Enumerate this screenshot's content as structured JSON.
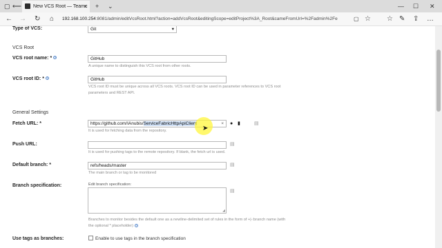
{
  "browser": {
    "tab_title": "New VCS Root — Teamc",
    "tab_close": "×",
    "new_tab": "+",
    "chevron": "⌄",
    "window_controls": {
      "minimize": "—",
      "maximize": "☐",
      "close": "✕"
    },
    "nav": {
      "back": "←",
      "forward": "→",
      "refresh": "↻",
      "home": "⌂"
    },
    "url_host": "192.168.100.254",
    "url_rest": ":8081/admin/editVcsRoot.html?action=addVcsRoot&editingScope=editProject%3A_Root&cameFromUrl=%2Fadmin%2Fe",
    "toolbar": {
      "reading": "▢",
      "favorite": "☆",
      "favorites_hub": "☆",
      "notes": "✎",
      "share": "⇪",
      "more": "…"
    }
  },
  "form": {
    "type_label": "Type of VCS:",
    "type_value": "Git",
    "type_arrow": "▾",
    "section_vcs_root": "VCS Root",
    "root_name_label": "VCS root name:",
    "root_name_req": "*",
    "root_name_value": "GitHub",
    "root_name_hint": "A unique name to distinguish this VCS root from other roots.",
    "root_id_label": "VCS root ID:",
    "root_id_req": "*",
    "root_id_value": "GitHub",
    "root_id_hint_1": "VCS root ID must be unique across all VCS roots. VCS root ID can be used in parameter references to VCS root",
    "root_id_hint_2": "parameters and REST API.",
    "section_general": "General Settings",
    "fetch_label": "Fetch URL:",
    "fetch_req": "*",
    "fetch_value_prefix": "https://github.com/IAnubis/",
    "fetch_value_selected": "ServiceFabricHttpApiClient",
    "fetch_clear": "×",
    "fetch_hint": "It is used for fetching data from the repository.",
    "push_label": "Push URL:",
    "push_value": "",
    "push_hint": "It is used for pushing tags to the remote repository. If blank, the fetch url is used.",
    "branch_label": "Default branch:",
    "branch_req": "*",
    "branch_value": "refs/heads/master",
    "branch_hint": "The main branch or tag to be monitored",
    "spec_label": "Branch specification:",
    "spec_edit_label": "Edit branch specification:",
    "spec_hint_1": "Branches to monitor besides the default one as a newline-delimited set of rules in the form of +|-:branch name (with",
    "spec_hint_2": "the optional * placeholder)",
    "tags_label": "Use tags as branches:",
    "tags_checkbox_label": "Enable to use tags in the branch specification",
    "help_glyph": "?",
    "icon_github": "●",
    "icon_trash": "▮",
    "icon_field": "▤",
    "resize_glyph": "◢"
  },
  "cursor": "➤"
}
